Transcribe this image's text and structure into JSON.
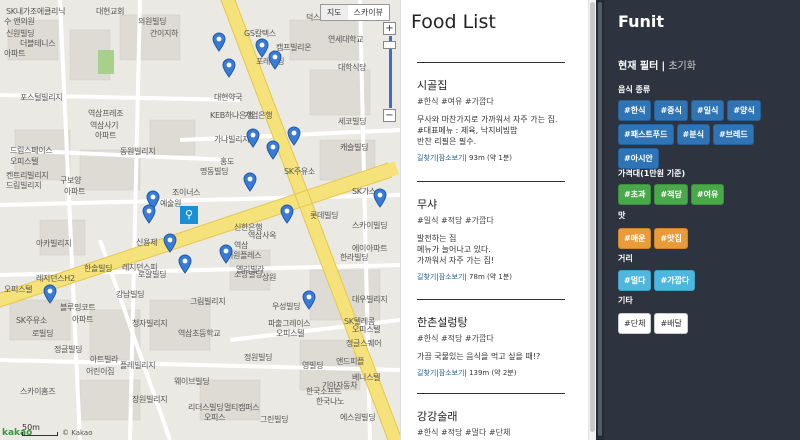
{
  "map": {
    "type_buttons": [
      "지도",
      "스카이뷰"
    ],
    "zoom_in": "+",
    "zoom_out": "−",
    "scale_label": "50m",
    "logo": "kakao",
    "copyright": "© Kakao",
    "labels": [
      "SK내가조에클리닉",
      "대현교회",
      "수 앤의원",
      "의원빌딩",
      "신원빌딩",
      "덕스테크리더스",
      "간이지하",
      "더블테니스",
      "GS칼텍스",
      "캠프빌리온",
      "아파트",
      "포레빌딩",
      "연세대학교",
      "대학식당",
      "포스털빌리지",
      "역삼프레조",
      "대현약국",
      "KEB하나은행",
      "기업은행",
      "역삼사기",
      "아파트",
      "동원빌리지",
      "가냐빌리지",
      "세코빌딩",
      "드림스페이스",
      "오피스텔",
      "명동빌딩",
      "켄트리빌리지",
      "캐슬빌딩",
      "조이너스",
      "SK주유소",
      "예술원",
      "홍도",
      "드림빌리지",
      "구보양",
      "아파트",
      "SK가스",
      "롯데빌딩",
      "아카빌리지",
      "레지던스피",
      "신용제",
      "한솔빌딩",
      "역삼사옥",
      "역삼",
      "신한은행",
      "스카이빌딩",
      "에이아파트",
      "더원플레스",
      "한라빌딩",
      "레지던스H2",
      "오피스텔",
      "로얄빌딩",
      "강남빌딩",
      "소망빌딩",
      "상원",
      "오피스텔",
      "로빌딩",
      "블루밍코트",
      "아파트",
      "SK주유소",
      "정글빌딩",
      "아트빌라",
      "파출그레이스",
      "오피스텔",
      "우성빌딩",
      "정글스퀘어",
      "어린이집",
      "영빌딩",
      "스카이홈즈",
      "한국소프트",
      "웨이브빌딩",
      "장원빌리지",
      "리더스빌딩",
      "오피스",
      "기아자동차",
      "역삼초등학교",
      "청자빌리지",
      "그림빌리지",
      "한국나노",
      "앤드피플",
      "베니스텔",
      "플레빌리지",
      "정원빌딩",
      "그린빌딩",
      "대우빌리지",
      "SK텔레콤",
      "엘리빌라",
      "멀티캠퍼스",
      "에스원빌딩"
    ]
  },
  "list": {
    "title": "Food List",
    "items": [
      {
        "name": "시골집",
        "tags": "#한식 #여유 #가깝다",
        "desc": "무사와 마찬가지로 가까워서 자주 가는 집.\n#대표메뉴 : 제육, 낙지비빔밥\n반찬 리필은 필수.",
        "link1": "길찾기",
        "link2": "잠소보기",
        "distance": "93m (약 1분)"
      },
      {
        "name": "무샤",
        "tags": "#일식 #적당 #가깝다",
        "desc": "발전하는 집\n메뉴가 늘어나고 있다.\n가까워서 자주 가는 집!",
        "link1": "길찾기",
        "link2": "잠소보기",
        "distance": "78m (약 1분)"
      },
      {
        "name": "한촌설렁탕",
        "tags": "#한식 #적당 #가깝다",
        "desc": "가끔 국물있는 음식을 먹고 싶을 때!?",
        "link1": "길찾기",
        "link2": "잠소보기",
        "distance": "139m (약 2분)"
      },
      {
        "name": "강강술래",
        "tags": "#한식 #적당 #멀다 #단체",
        "desc": "",
        "link1": "",
        "link2": "",
        "distance": ""
      }
    ]
  },
  "panel": {
    "brand": "Funit",
    "current_filter": "현재 필터",
    "separator": "|",
    "reset": "초기화",
    "sections": [
      {
        "title": "음식 종류",
        "color": "blue",
        "tags": [
          "#한식",
          "#중식",
          "#일식",
          "#양식",
          "#패스트푸드",
          "#분식",
          "#브레드",
          "#아시안"
        ]
      },
      {
        "title": "가격대(1만원 기준)",
        "color": "green",
        "tags": [
          "#초과",
          "#적당",
          "#여유"
        ]
      },
      {
        "title": "맛",
        "color": "orange",
        "tags": [
          "#매운",
          "#맛집"
        ]
      },
      {
        "title": "거리",
        "color": "cyan",
        "tags": [
          "#멀다",
          "#가깝다"
        ]
      },
      {
        "title": "기타",
        "color": "white",
        "tags": [
          "#단체",
          "#배달"
        ]
      }
    ]
  }
}
